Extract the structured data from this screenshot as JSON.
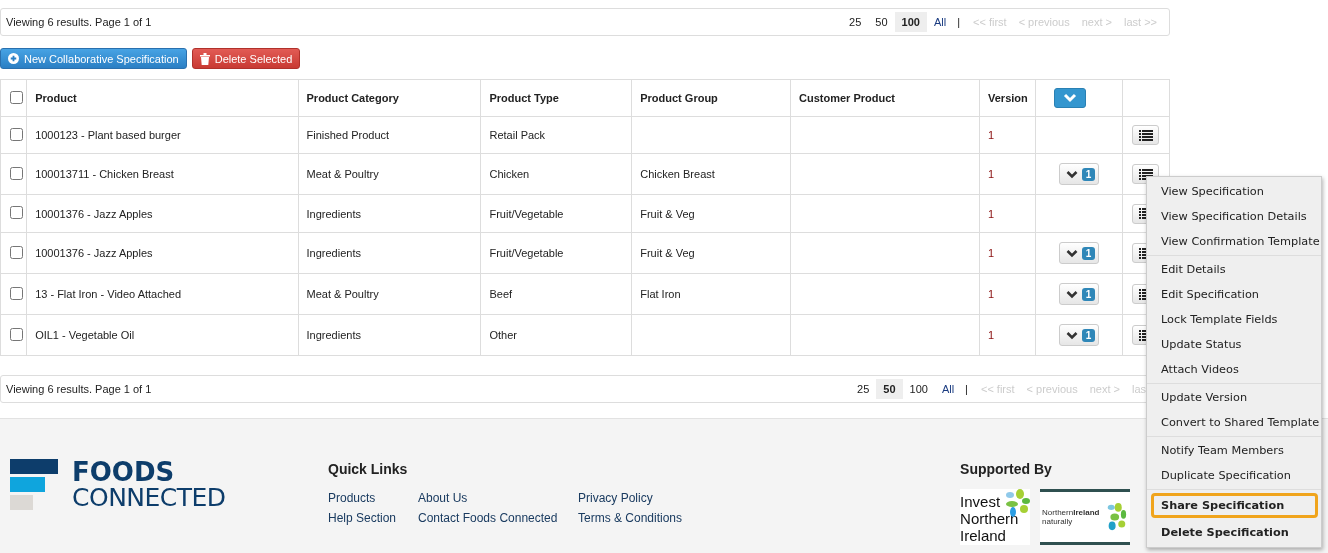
{
  "pager_top": {
    "summary": "Viewing 6 results. Page 1 of 1",
    "sizes": [
      {
        "label": "25",
        "selected": false
      },
      {
        "label": "50",
        "selected": false
      },
      {
        "label": "100",
        "selected": true
      },
      {
        "label": "All",
        "selected": false
      }
    ],
    "separator": "|",
    "nav": [
      {
        "label": "<< first",
        "disabled": true
      },
      {
        "label": "< previous",
        "disabled": true
      },
      {
        "label": "next >",
        "disabled": true
      },
      {
        "label": "last >>",
        "disabled": true
      }
    ]
  },
  "actions": [
    {
      "label": "New Collaborative Specification",
      "kind": "primary"
    },
    {
      "label": "Delete Selected",
      "kind": "danger"
    }
  ],
  "table": {
    "select_all": {
      "checked": false
    },
    "columns": [
      "Product",
      "Product Category",
      "Product Type",
      "Product Group",
      "Customer Product",
      "Version"
    ],
    "rows": [
      {
        "checked": false,
        "cells": [
          "1000123 - Plant based burger",
          "Finished Product",
          "Retail Pack",
          "",
          "",
          "1"
        ]
      },
      {
        "checked": false,
        "cells": [
          "100013711 - Chicken Breast",
          "Meat & Poultry",
          "Chicken",
          "Chicken Breast",
          "",
          "1"
        ],
        "count": "1"
      },
      {
        "checked": false,
        "cells": [
          "10001376 - Jazz Apples",
          "Ingredients",
          "Fruit/Vegetable",
          "Fruit & Veg",
          "",
          "1"
        ]
      },
      {
        "checked": false,
        "cells": [
          "10001376 - Jazz Apples",
          "Ingredients",
          "Fruit/Vegetable",
          "Fruit & Veg",
          "",
          "1"
        ],
        "count": "1"
      },
      {
        "checked": false,
        "cells": [
          "13 - Flat Iron - Video Attached",
          "Meat & Poultry",
          "Beef",
          "Flat Iron",
          "",
          "1"
        ],
        "count": "1"
      },
      {
        "checked": false,
        "cells": [
          "OIL1 - Vegetable Oil",
          "Ingredients",
          "Other",
          "",
          "",
          "1"
        ],
        "count": "1"
      }
    ]
  },
  "pager_bottom": {
    "summary": "Viewing 6 results. Page 1 of 1",
    "sizes": [
      {
        "label": "25",
        "selected": false
      },
      {
        "label": "50",
        "selected": true
      },
      {
        "label": "100",
        "selected": false
      },
      {
        "label": "All",
        "selected": false
      }
    ],
    "separator": "|",
    "nav": [
      {
        "label": "<< first",
        "disabled": true
      },
      {
        "label": "< previous",
        "disabled": true
      },
      {
        "label": "next >",
        "disabled": true
      },
      {
        "label": "las",
        "disabled": true
      }
    ]
  },
  "context_menu": {
    "groups": [
      [
        {
          "label": "View Specification",
          "selected": false,
          "bold": false
        },
        {
          "label": "View Specification Details",
          "selected": false,
          "bold": false
        },
        {
          "label": "View Confirmation Template",
          "selected": false,
          "bold": false
        }
      ],
      [
        {
          "label": "Edit Details",
          "selected": false,
          "bold": false
        },
        {
          "label": "Edit Specification",
          "selected": false,
          "bold": false
        },
        {
          "label": "Lock Template Fields",
          "selected": false,
          "bold": false
        },
        {
          "label": "Update Status",
          "selected": false,
          "bold": false
        },
        {
          "label": "Attach Videos",
          "selected": false,
          "bold": false
        }
      ],
      [
        {
          "label": "Update Version",
          "selected": false,
          "bold": false
        },
        {
          "label": "Convert to Shared Template",
          "selected": false,
          "bold": false
        }
      ],
      [
        {
          "label": "Notify Team Members",
          "selected": false,
          "bold": false
        },
        {
          "label": "Duplicate Specification",
          "selected": false,
          "bold": false
        }
      ],
      [
        {
          "label": "Share Specification",
          "selected": true,
          "bold": true
        },
        {
          "label": "Delete Specification",
          "selected": false,
          "bold": true
        }
      ]
    ]
  },
  "footer": {
    "logo": {
      "line_1": "FOODS",
      "line_2": "CONNECTED"
    },
    "quick_links": {
      "title": "Quick Links",
      "columns": [
        [
          "Products",
          "Help Section"
        ],
        [
          "About Us",
          "Contact Foods Connected"
        ],
        [
          "Privacy Policy",
          "Terms & Conditions"
        ]
      ]
    },
    "supported_by": {
      "title": "Supported By",
      "invest_logo": [
        "Invest",
        "Northern",
        "Ireland"
      ],
      "ni_logo": {
        "name_regular": "Northern",
        "name_bold": "Ireland",
        "tagline": "naturally"
      }
    }
  }
}
